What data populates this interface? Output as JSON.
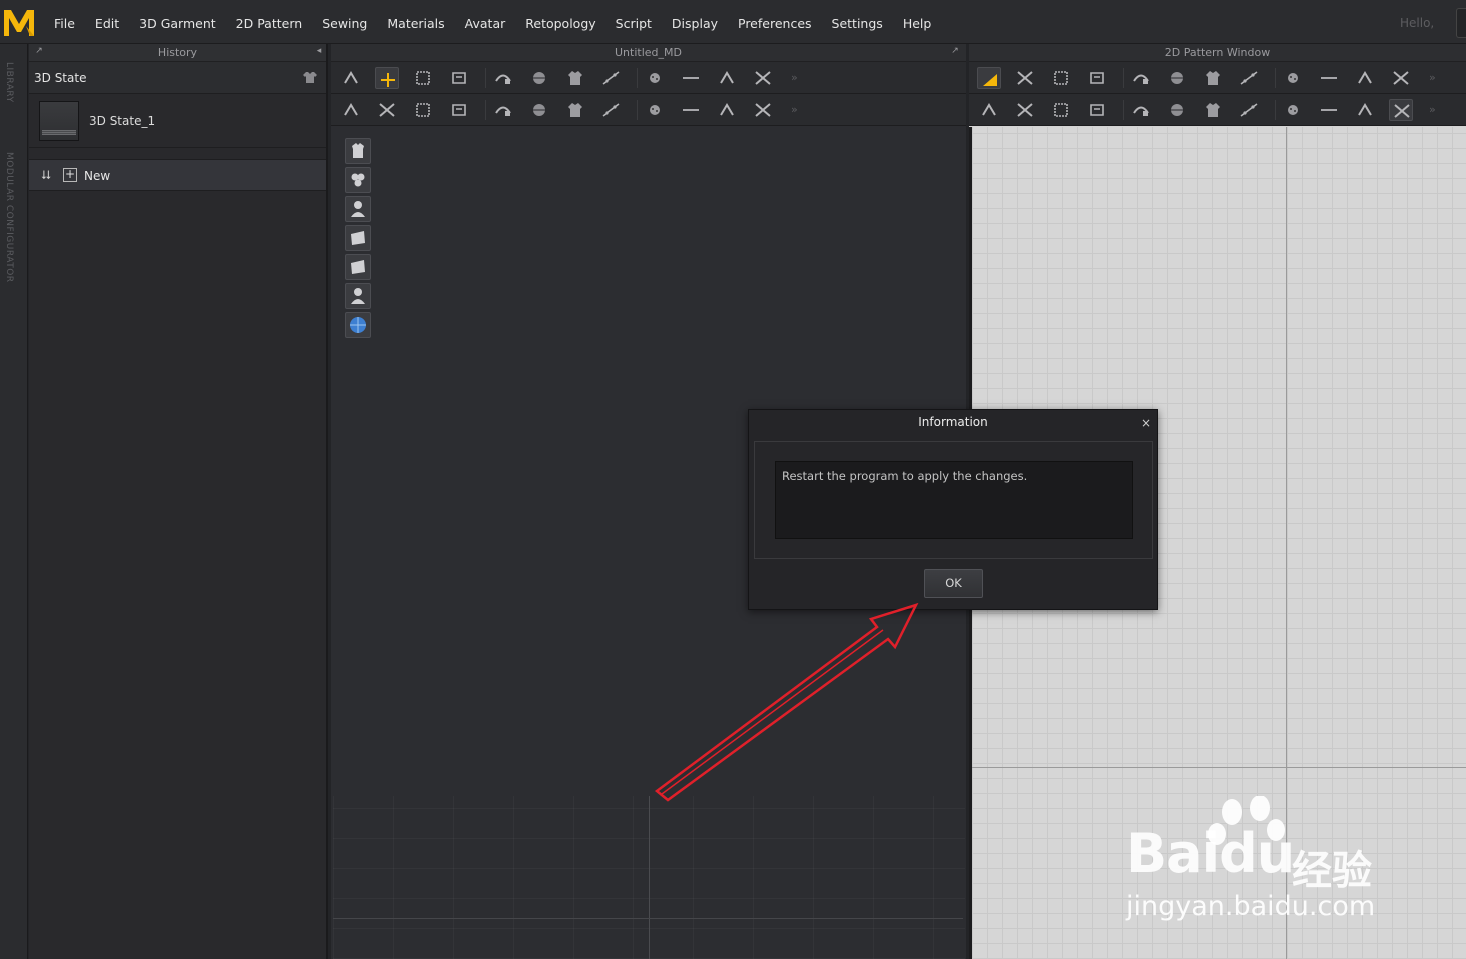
{
  "app": {
    "logo_letter": "M",
    "accent_color": "#f5b70b",
    "greeting": "Hello,"
  },
  "menu": [
    "File",
    "Edit",
    "3D Garment",
    "2D Pattern",
    "Sewing",
    "Materials",
    "Avatar",
    "Retopology",
    "Script",
    "Display",
    "Preferences",
    "Settings",
    "Help"
  ],
  "left_strip": {
    "library": "LIBRARY",
    "modular": "MODULAR CONFIGURATOR"
  },
  "history": {
    "title": "History",
    "section": "3D State",
    "item": "3D State_1",
    "new_label": "New"
  },
  "window3d": {
    "title": "Untitled_MD"
  },
  "window2d": {
    "title": "2D Pattern Window"
  },
  "toolbar_icons_3d_row1": [
    "select-move-icon",
    "transform-icon",
    "box-select-icon",
    "edit-pattern-icon",
    "segment-sewing-icon",
    "free-sewing-icon",
    "multi-sewing-icon",
    "pin-icon",
    "fold-arrangement-icon",
    "tack-icon",
    "arrangement-icon",
    "arrangement-point-icon"
  ],
  "toolbar_icons_3d_row2": [
    "simulation-icon",
    "avatar-measure-icon",
    "garment-measure-icon",
    "internal-line-icon",
    "zip-icon",
    "buttonhole-icon",
    "stitch-icon",
    "topstitch-icon",
    "texture-icon",
    "button-icon",
    "graphic-icon",
    "line-icon"
  ],
  "viewport_side_tools": [
    "garment-view-icon",
    "fabric-view-icon",
    "avatar-view-icon",
    "wireframe-view-icon",
    "thickness-view-icon",
    "avatar-silhouette-icon",
    "environment-icon"
  ],
  "toolbar_icons_2d_row1": [
    "transform-pattern-icon",
    "edit-point-icon",
    "curve-point-icon",
    "edit-curvature-icon",
    "add-point-icon",
    "edit-segment-icon",
    "polygon-icon",
    "rectangle-icon",
    "ellipse-icon",
    "internal-polygon-icon",
    "fold-icon",
    "gather-icon"
  ],
  "toolbar_icons_2d_row2": [
    "segment-sewing-2d-icon",
    "free-sewing-2d-icon",
    "multi-sewing-2d-icon",
    "trace-icon",
    "notch-icon",
    "iron-icon",
    "fabric-2d-icon",
    "texture-2d-icon",
    "edit-texture-icon",
    "graphic-2d-icon",
    "button-2d-icon",
    "topstitch-2d-icon"
  ],
  "dialog": {
    "title": "Information",
    "close": "×",
    "message": "Restart the program to apply the changes.",
    "ok": "OK"
  },
  "annotation": {
    "arrow_color": "#e0202a"
  },
  "watermark": {
    "brand": "Bai",
    "brand_tail": "du",
    "cn": "经验",
    "url": "jingyan.baidu.com"
  }
}
